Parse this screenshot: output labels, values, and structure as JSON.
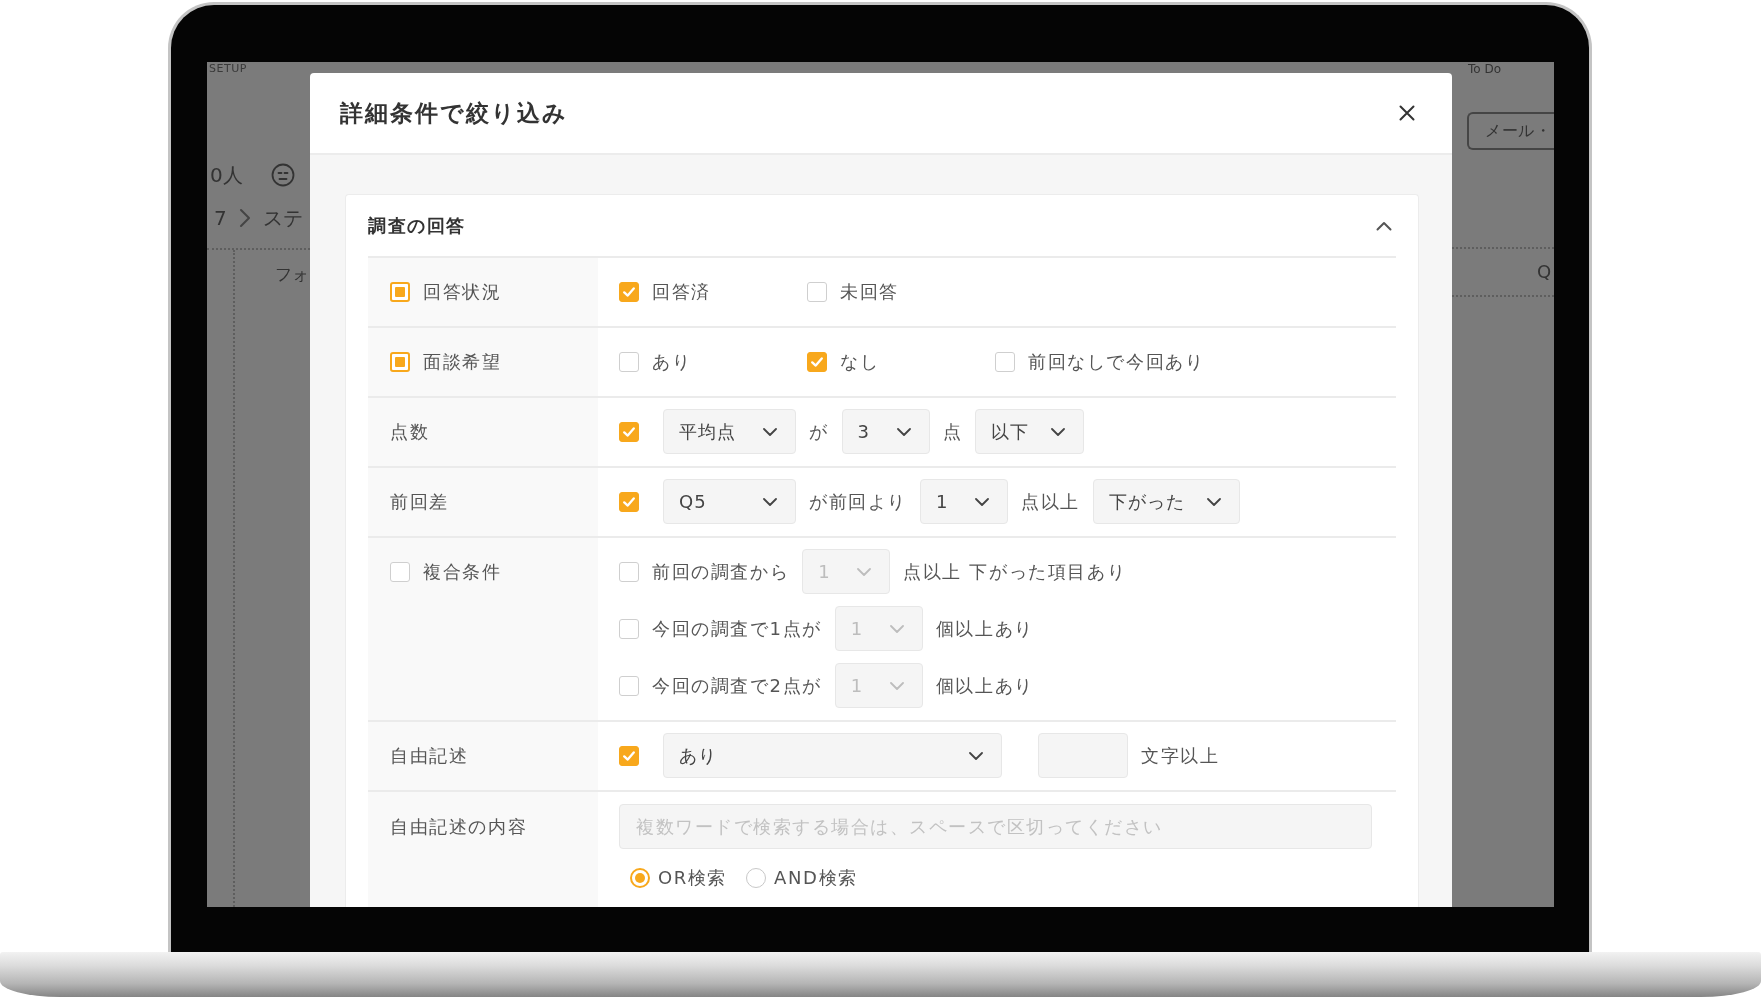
{
  "background_app": {
    "setup_label": "SETUP",
    "count": "0人",
    "breadcrumb": [
      "7",
      "ステ"
    ],
    "column_header": "フォ",
    "todo_label": "To Do",
    "mail_button": "メール・",
    "right_column_header": "Q"
  },
  "dialog": {
    "title": "詳細条件で絞り込み",
    "sections": [
      {
        "title": "調査の回答",
        "expanded": true,
        "rows": [
          {
            "kind": "options",
            "label": {
              "text": "回答状況",
              "checkbox": {
                "indeterminate": true
              }
            },
            "lines": [
              [
                {
                  "kind": "option",
                  "label": "回答済",
                  "checked": true
                },
                {
                  "kind": "option",
                  "label": "未回答",
                  "checked": false
                }
              ]
            ]
          },
          {
            "kind": "options",
            "label": {
              "text": "面談希望",
              "checkbox": {
                "indeterminate": true
              }
            },
            "lines": [
              [
                {
                  "kind": "option",
                  "label": "あり",
                  "checked": false
                },
                {
                  "kind": "option",
                  "label": "なし",
                  "checked": true
                },
                {
                  "kind": "option",
                  "label": "前回なしで今回あり",
                  "checked": false
                }
              ]
            ]
          },
          {
            "kind": "condition",
            "label": {
              "text": "点数"
            },
            "lines": [
              [
                {
                  "kind": "checkbox",
                  "checked": true
                },
                {
                  "kind": "select",
                  "value": "平均点",
                  "disabled": false
                },
                {
                  "kind": "text",
                  "text": "が"
                },
                {
                  "kind": "select",
                  "value": "3",
                  "disabled": false
                },
                {
                  "kind": "text",
                  "text": "点"
                },
                {
                  "kind": "select",
                  "value": "以下",
                  "disabled": false
                }
              ]
            ]
          },
          {
            "kind": "condition",
            "label": {
              "text": "前回差"
            },
            "lines": [
              [
                {
                  "kind": "checkbox",
                  "checked": true
                },
                {
                  "kind": "select",
                  "value": "Q5",
                  "disabled": false
                },
                {
                  "kind": "text",
                  "text": "が前回より"
                },
                {
                  "kind": "select",
                  "value": "1",
                  "disabled": false
                },
                {
                  "kind": "text",
                  "text": "点以上"
                },
                {
                  "kind": "select",
                  "value": "下がった",
                  "disabled": false
                }
              ]
            ]
          },
          {
            "kind": "multi",
            "label": {
              "text": "複合条件",
              "checkbox": {
                "indeterminate": false
              }
            },
            "lines": [
              [
                {
                  "kind": "option",
                  "label": "前回の調査から",
                  "checked": false
                },
                {
                  "kind": "select",
                  "value": "1",
                  "disabled": true
                },
                {
                  "kind": "text",
                  "text": "点以上 下がった項目あり"
                }
              ],
              [
                {
                  "kind": "option",
                  "label": "今回の調査で1点が",
                  "checked": false
                },
                {
                  "kind": "select",
                  "value": "1",
                  "disabled": true
                },
                {
                  "kind": "text",
                  "text": "個以上あり"
                }
              ],
              [
                {
                  "kind": "option",
                  "label": "今回の調査で2点が",
                  "checked": false
                },
                {
                  "kind": "select",
                  "value": "1",
                  "disabled": true
                },
                {
                  "kind": "text",
                  "text": "個以上あり"
                }
              ]
            ]
          },
          {
            "kind": "free_text",
            "label": {
              "text": "自由記述"
            },
            "lines": [
              [
                {
                  "kind": "checkbox",
                  "checked": true
                },
                {
                  "kind": "select",
                  "value": "あり",
                  "disabled": false
                },
                {
                  "kind": "input"
                },
                {
                  "kind": "text",
                  "text": "文字以上"
                }
              ]
            ]
          },
          {
            "kind": "keyword",
            "label": {
              "text": "自由記述の内容"
            },
            "lines": [
              [
                {
                  "kind": "input",
                  "placeholder": "複数ワードで検索する場合は、スペースで区切ってください"
                }
              ],
              [
                {
                  "kind": "radio",
                  "label": "OR検索",
                  "selected": true
                },
                {
                  "kind": "radio",
                  "label": "AND検索",
                  "selected": false
                }
              ]
            ]
          }
        ]
      }
    ]
  }
}
